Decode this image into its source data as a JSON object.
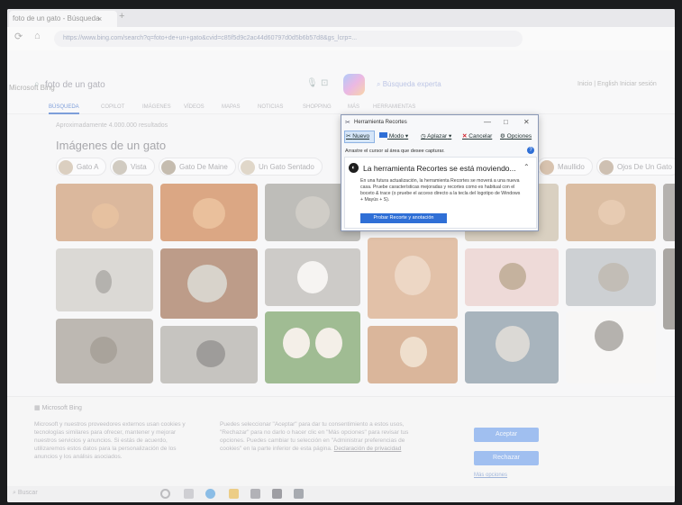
{
  "browser": {
    "tab_title": "foto de un gato - Búsqueda",
    "tab_close": "×",
    "new_tab": "+",
    "url": "https://www.bing.com/search?q=foto+de+un+gato&cvid=c85f5d9c2ac44d60797d0d5b6b57d8&gs_lcrp=..."
  },
  "bing": {
    "logo": "Microsoft Bing",
    "query": "foto de un gato",
    "deep_search": "Búsqueda experta",
    "languages": "Inicio | English   Iniciar sesión",
    "tabs": [
      "BÚSQUEDA",
      "COPILOT",
      "IMÁGENES",
      "VÍDEOS",
      "MAPAS",
      "NOTICIAS",
      "SHOPPING",
      "MÁS",
      "HERRAMIENTAS"
    ],
    "results_count": "Aproximadamente 4.000.000 resultados",
    "section_heading": "Imágenes de un gato",
    "chips": [
      "Gato A",
      "Vista",
      "Gato De Maine",
      "Un Gato Sentado",
      "Maullido",
      "Ojos De Un Gato"
    ]
  },
  "snipping_tool": {
    "title": "Herramienta Recortes",
    "minimize": "—",
    "maximize": "□",
    "close": "✕",
    "new_label": "Nuevo",
    "mode_label": "Modo",
    "delay_label": "Aplazar",
    "cancel_label": "Cancelar",
    "options_label": "Opciones",
    "hint": "Arrastre el cursor al área que desee capturar.",
    "notice_title": "La herramienta Recortes se está moviendo...",
    "notice_body": "En una futura actualización, la herramienta Recortes se moverá a una nueva casa. Pruebe características mejoradas y recortes como es habitual con el boceto & trace (o pruebe el acceso directo a la tecla del logotipo de Windows + Mayús + S).",
    "notice_button": "Probar Recorte y anotación"
  },
  "consent": {
    "brand": "Microsoft Bing",
    "left_text": "Microsoft y nuestros proveedores externos usan cookies y tecnologías similares para ofrecer, mantener y mejorar nuestros servicios y anuncios. Si estás de acuerdo, utilizaremos estos datos para la personalización de los anuncios y los análisis asociados.",
    "right_text": "Puedes seleccionar \"Aceptar\" para dar tu consentimiento a estos usos, \"Rechazar\" para no darlo o hacer clic en \"Más opciones\" para revisar tus opciones. Puedes cambiar tu selección en \"Administrar preferencias de cookies\" en la parte inferior de esta página.",
    "privacy_link": "Declaración de privacidad",
    "accept": "Aceptar",
    "reject": "Rechazar",
    "more_options": "Más opciones"
  },
  "taskbar": {
    "search": "Buscar"
  },
  "colors": {
    "accent": "#2f6fd6",
    "link": "#3b6cc7"
  }
}
